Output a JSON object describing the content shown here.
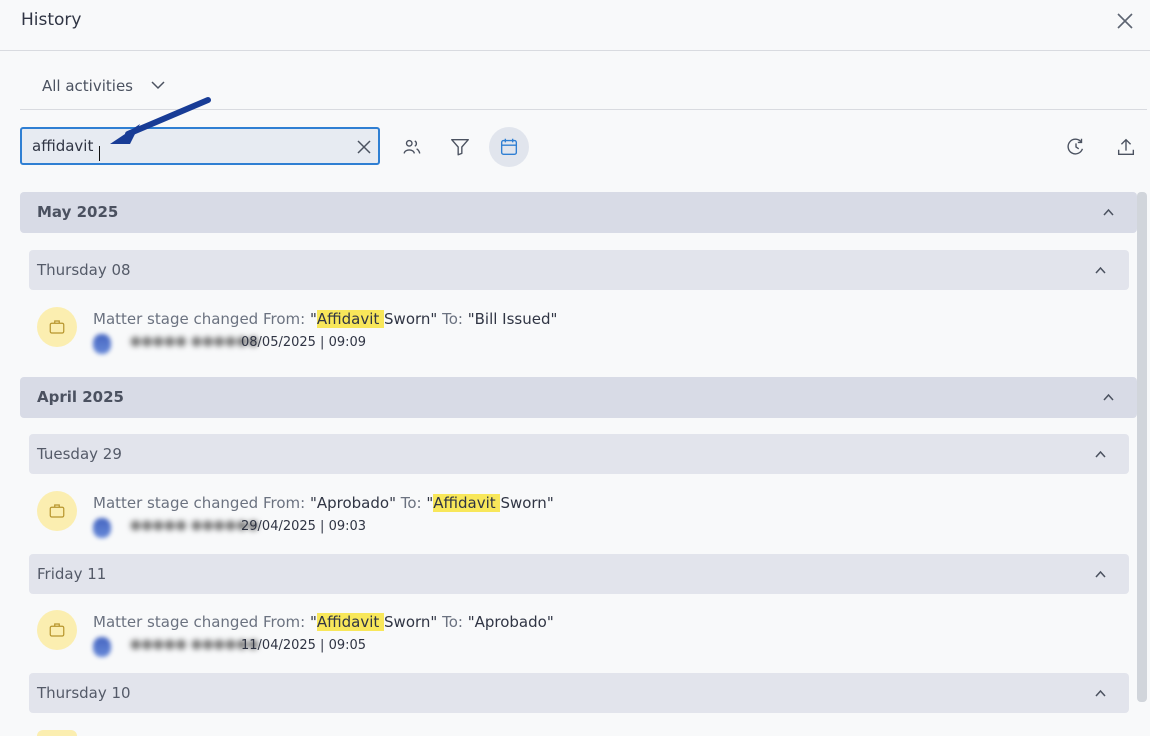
{
  "header": {
    "title": "History"
  },
  "filter": {
    "activities_label": "All activities"
  },
  "search": {
    "value": "affidavit"
  },
  "colors": {
    "accent": "#2f7fd3",
    "highlight": "#f8e75a",
    "entry_icon_bg": "#fbeeb0",
    "arrow": "#183c96"
  },
  "icons": [
    "close-icon",
    "chevron-down-icon",
    "users-icon",
    "filter-icon",
    "calendar-icon",
    "history-icon",
    "upload-icon",
    "briefcase-icon",
    "chevron-up-icon"
  ],
  "history": {
    "months": [
      {
        "label": "May 2025",
        "days": [
          {
            "label": "Thursday 08",
            "entries": [
              {
                "prefix": "Matter stage changed From: ",
                "from_open": "\"",
                "from_highlight": "Affidavit ",
                "from_rest": "Sworn\"",
                "middle": " To: ",
                "to_open": "\"",
                "to_highlight": "",
                "to_rest": "Bill Issued\"",
                "timestamp": "08/05/2025 | 09:09"
              }
            ]
          }
        ]
      },
      {
        "label": "April 2025",
        "days": [
          {
            "label": "Tuesday 29",
            "entries": [
              {
                "prefix": "Matter stage changed From: ",
                "from_open": "\"",
                "from_highlight": "",
                "from_rest": "Aprobado\"",
                "middle": " To: ",
                "to_open": "\"",
                "to_highlight": "Affidavit ",
                "to_rest": "Sworn\"",
                "timestamp": "29/04/2025 | 09:03"
              }
            ]
          },
          {
            "label": "Friday 11",
            "entries": [
              {
                "prefix": "Matter stage changed From: ",
                "from_open": "\"",
                "from_highlight": "Affidavit ",
                "from_rest": "Sworn\"",
                "middle": " To: ",
                "to_open": "\"",
                "to_highlight": "",
                "to_rest": "Aprobado\"",
                "timestamp": "11/04/2025 | 09:05"
              }
            ]
          },
          {
            "label": "Thursday 10",
            "entries": []
          }
        ]
      }
    ]
  }
}
